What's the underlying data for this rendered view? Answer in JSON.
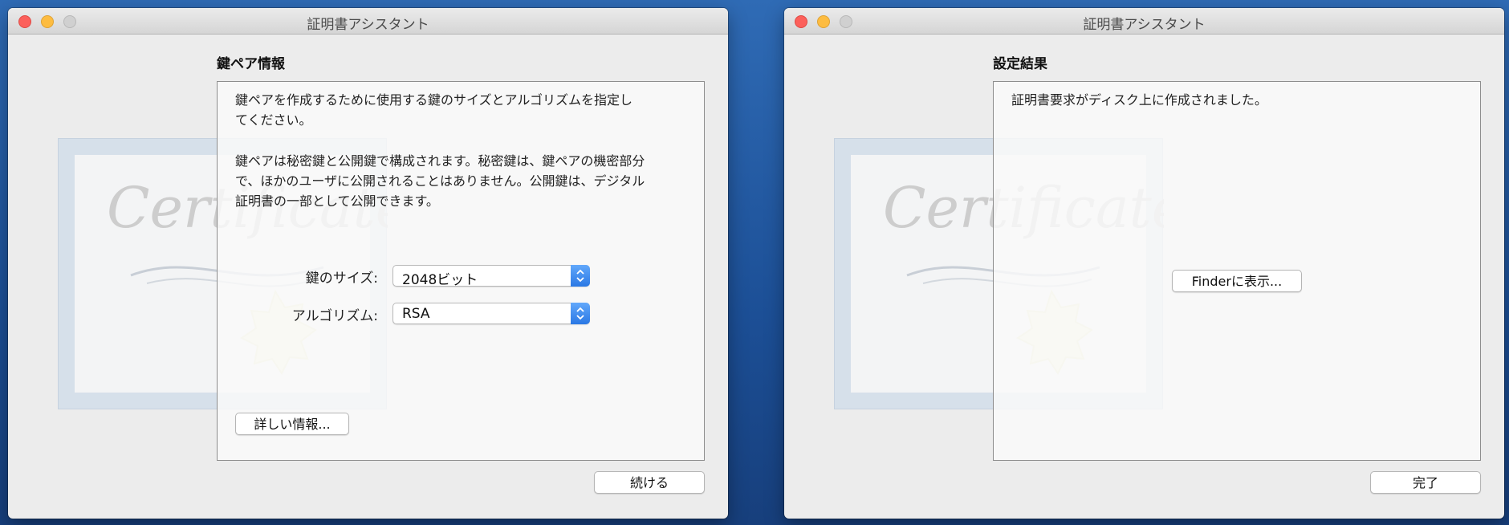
{
  "window1": {
    "title": "証明書アシスタント",
    "section_heading": "鍵ペア情報",
    "paragraph1": "鍵ペアを作成するために使用する鍵のサイズとアルゴリズムを指定し\nてください。",
    "paragraph2": "鍵ペアは秘密鍵と公開鍵で構成されます。秘密鍵は、鍵ペアの機密部分\nで、ほかのユーザに公開されることはありません。公開鍵は、デジタル\n証明書の一部として公開できます。",
    "key_size_label": "鍵のサイズ:",
    "key_size_value": "2048ビット",
    "algorithm_label": "アルゴリズム:",
    "algorithm_value": "RSA",
    "more_info_button": "詳しい情報...",
    "continue_button": "続ける"
  },
  "window2": {
    "title": "証明書アシスタント",
    "section_heading": "設定結果",
    "message": "証明書要求がディスク上に作成されました。",
    "show_in_finder_button": "Finderに表示...",
    "done_button": "完了"
  },
  "colors": {
    "desktop": "#1f55a0",
    "close": "#fc605b",
    "minimize": "#fdbc40",
    "zoom_disabled": "#d0d0d0",
    "popup_accent": "#2a78e4"
  },
  "icons": [
    "certificate-watermark-icon",
    "popup-stepper-icon"
  ]
}
